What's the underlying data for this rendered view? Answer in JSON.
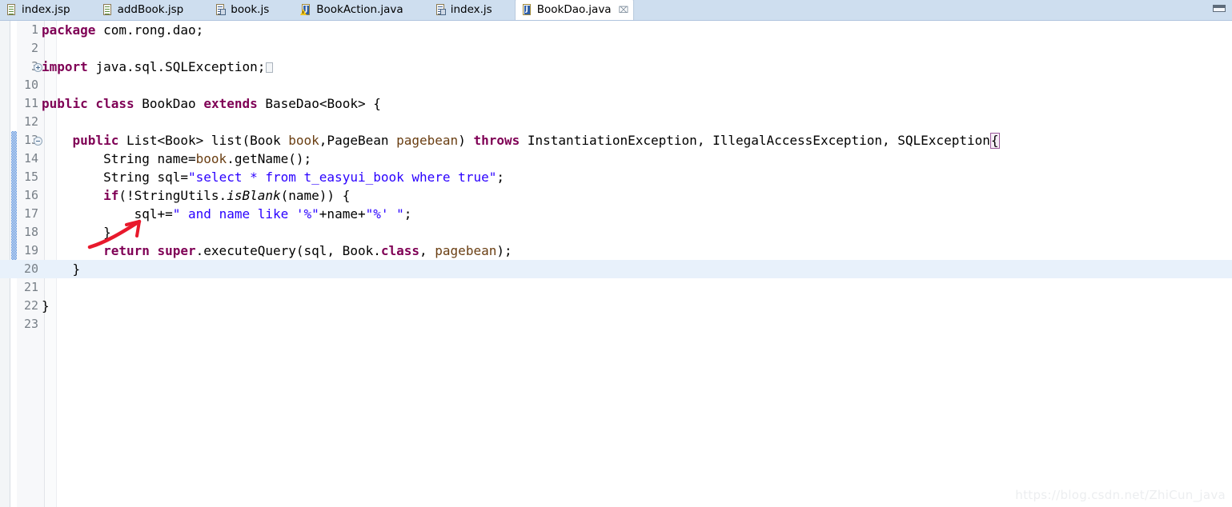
{
  "window": {
    "restore_button": "restore-window"
  },
  "tabs": [
    {
      "label": "index.jsp",
      "icon": "jsp-file-icon",
      "active": false,
      "close": ""
    },
    {
      "label": "addBook.jsp",
      "icon": "jsp-file-icon",
      "active": false,
      "close": ""
    },
    {
      "label": "book.js",
      "icon": "js-file-icon",
      "active": false,
      "close": ""
    },
    {
      "label": "BookAction.java",
      "icon": "java-file-warning-icon",
      "active": false,
      "close": ""
    },
    {
      "label": "index.js",
      "icon": "js-file-icon",
      "active": false,
      "close": ""
    },
    {
      "label": "BookDao.java",
      "icon": "java-file-icon",
      "active": true,
      "close": "⌧"
    }
  ],
  "editor": {
    "active_file": "BookDao.java",
    "current_line": 20,
    "changed_lines": [
      13,
      14,
      15,
      16,
      17,
      18,
      19,
      20
    ],
    "lines": [
      {
        "no": "1",
        "fold": "",
        "text": "package com.rong.dao;"
      },
      {
        "no": "2",
        "fold": "",
        "text": ""
      },
      {
        "no": "3",
        "fold": "plus",
        "text": "import java.sql.SQLException;"
      },
      {
        "no": "10",
        "fold": "",
        "text": ""
      },
      {
        "no": "11",
        "fold": "",
        "text": "public class BookDao extends BaseDao<Book> {"
      },
      {
        "no": "12",
        "fold": "",
        "text": ""
      },
      {
        "no": "13",
        "fold": "minus",
        "text": "    public List<Book> list(Book book,PageBean pagebean) throws InstantiationException, IllegalAccessException, SQLException{"
      },
      {
        "no": "14",
        "fold": "",
        "text": "        String name=book.getName();"
      },
      {
        "no": "15",
        "fold": "",
        "text": "        String sql=\"select * from t_easyui_book where true\";"
      },
      {
        "no": "16",
        "fold": "",
        "text": "        if(!StringUtils.isBlank(name)) {"
      },
      {
        "no": "17",
        "fold": "",
        "text": "            sql+=\" and name like '%\"+name+\"%' \";"
      },
      {
        "no": "18",
        "fold": "",
        "text": "        }"
      },
      {
        "no": "19",
        "fold": "",
        "text": "        return super.executeQuery(sql, Book.class, pagebean);"
      },
      {
        "no": "20",
        "fold": "",
        "text": "    }"
      },
      {
        "no": "21",
        "fold": "",
        "text": ""
      },
      {
        "no": "22",
        "fold": "",
        "text": "}"
      },
      {
        "no": "23",
        "fold": "",
        "text": ""
      }
    ]
  },
  "annotation": {
    "arrow_color": "#e8192c",
    "arrow_target": "if-statement-line-16"
  },
  "watermark": {
    "text": "https://blog.csdn.net/ZhiCun_java"
  },
  "colors": {
    "keyword": "#7f0055",
    "string": "#2a00ff",
    "parameter": "#6a3e12",
    "tabbar_bg": "#cedeef",
    "current_line_bg": "#e8f1fb",
    "changebar": "#3a7bd5"
  }
}
